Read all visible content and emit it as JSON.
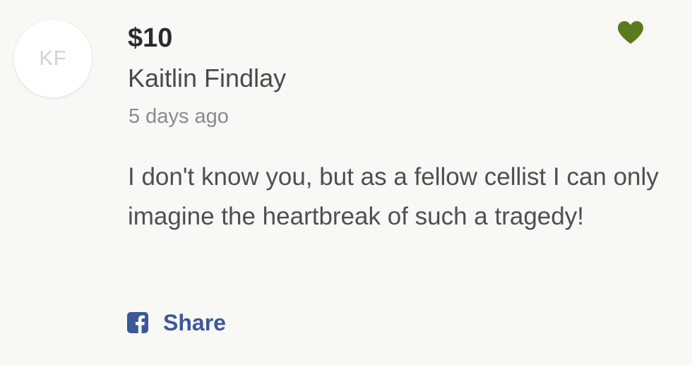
{
  "donation": {
    "avatar_initials": "KF",
    "amount": "$10",
    "donor_name": "Kaitlin Findlay",
    "timestamp": "5 days ago",
    "message": "I don't know you, but as a fellow cellist I can only imagine the heartbreak of such a tragedy!",
    "share_label": "Share",
    "heart_icon": "heart-icon",
    "facebook_icon": "facebook-icon"
  },
  "colors": {
    "background": "#f8f8f5",
    "heart": "#5a7a1e",
    "facebook": "#3b5998",
    "amount_text": "#2b2b2b",
    "body_text": "#4f4f4f",
    "muted_text": "#8a8a8a"
  }
}
